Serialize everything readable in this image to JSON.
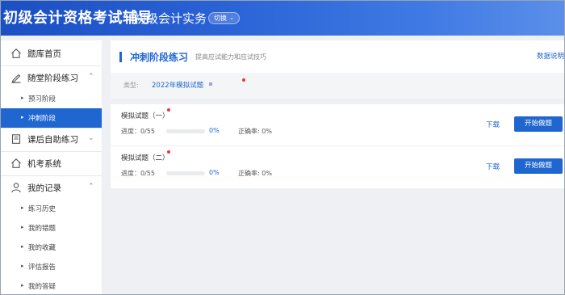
{
  "header": {
    "brand": "初级会计资格考试辅导",
    "subject": "初级会计实务",
    "switch_label": "切换"
  },
  "sidebar": {
    "groups": [
      {
        "label": "题库首页",
        "icon": "home-icon"
      },
      {
        "label": "随堂阶段练习",
        "icon": "pen-icon"
      },
      {
        "label": "课后自助练习",
        "icon": "book-icon"
      },
      {
        "label": "机考系统",
        "icon": "home-icon"
      },
      {
        "label": "我的记录",
        "icon": "user-icon"
      }
    ],
    "stage_items": [
      "预习阶段",
      "冲刺阶段"
    ],
    "record_items": [
      "练习历史",
      "我的错题",
      "我的收藏",
      "评估报告",
      "我的答疑"
    ]
  },
  "main": {
    "title": "冲刺阶段练习",
    "subtitle": "提高应试能力和应试技巧",
    "help_link": "数据说明",
    "filter": {
      "label": "类型:",
      "value": "2022年模拟试题"
    },
    "exams": [
      {
        "name": "模拟试题（一）",
        "progress_label": "进度：0/55",
        "progress": 0,
        "percent": "0%",
        "accuracy": "正确率: 0%",
        "download": "下载",
        "start": "开始做题"
      },
      {
        "name": "模拟试题（二）",
        "progress_label": "进度：0/55",
        "progress": 0,
        "percent": "0%",
        "accuracy": "正确率: 0%",
        "download": "下载",
        "start": "开始做题"
      }
    ]
  },
  "colors": {
    "accent": "#1f66d1",
    "header": "#2a63d6",
    "badge": "#e53935"
  }
}
